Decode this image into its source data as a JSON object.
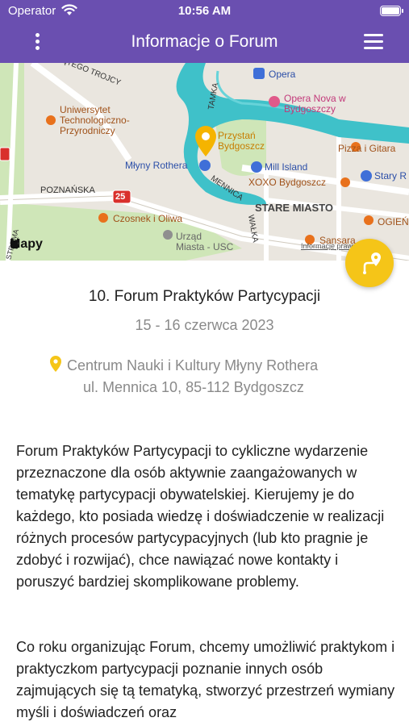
{
  "status_bar": {
    "carrier": "Operator",
    "time": "10:56 AM"
  },
  "header": {
    "title": "Informacje o Forum"
  },
  "map": {
    "brand": "Mapy",
    "legal": "Informacje prawne",
    "streets": [
      "ŚWIĘTEGO TROJCY",
      "POZNAŃSKA",
      "TAMKA",
      "MENNICA",
      "WAŁKA",
      "STROMA"
    ],
    "district": "STARE MIASTO",
    "road_badge": "25",
    "places": {
      "university": "Uniwersytet\nTechnologiczno-\nPrzyrodniczy",
      "mlyny": "Młyny Rothera",
      "przystan": "Przystań\nBydgoszcz",
      "opera_transit": "Opera",
      "opera_nova": "Opera Nova w\nBydgoszczy",
      "mill_island": "Mill Island",
      "xoxo": "XOXO Bydgoszcz",
      "pizza": "Pizza i Gitara",
      "stary": "Stary R",
      "ogien": "OGIEŃ",
      "czosnek": "Czosnek i Oliwa",
      "urzad": "Urząd\nMiasta - USC",
      "sansara": "Sansara"
    }
  },
  "event": {
    "title": "10. Forum Praktyków Partycypacji",
    "date": "15 - 16 czerwca 2023",
    "venue_name": "Centrum Nauki i Kultury Młyny Rothera",
    "venue_address": "ul. Mennica 10, 85-112 Bydgoszcz"
  },
  "description": {
    "p1": "Forum Praktyków Partycypacji to cykliczne wydarzenie przeznaczone dla osób aktywnie zaangażowanych w tematykę partycypacji obywatelskiej. Kierujemy je do każdego, kto posiada wiedzę i doświadczenie w realizacji różnych procesów partycypacyjnych (lub kto pragnie je zdobyć i rozwijać), chce nawiązać nowe kontakty i poruszyć bardziej skomplikowane problemy.",
    "p2": "Co roku organizując Forum, chcemy umożliwić praktykom i praktyczkom partycypacji poznanie innych osób zajmujących się tą tematyką, stworzyć przestrzeń wymiany myśli i doświadczeń oraz"
  },
  "colors": {
    "header": "#6a4fb0",
    "accent": "#f5c518",
    "poi_orange": "#e8711c",
    "poi_blue": "#3f6fd8",
    "river": "#3fc1c9"
  },
  "icons": [
    "wifi-icon",
    "battery-icon",
    "more-vertical-icon",
    "hamburger-menu-icon",
    "location-pin-icon",
    "route-icon",
    "apple-logo-icon"
  ]
}
